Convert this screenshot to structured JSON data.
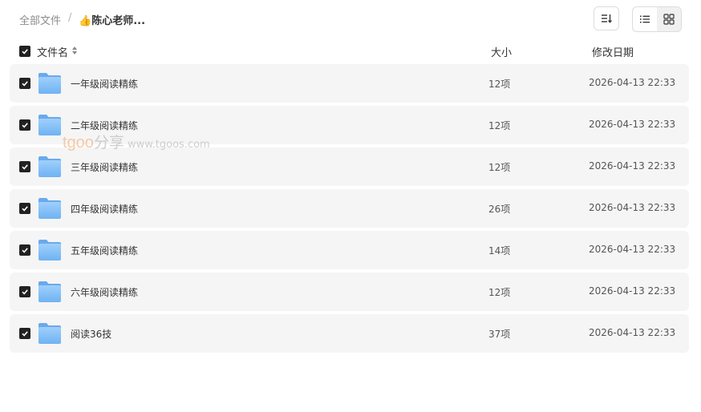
{
  "breadcrumb": {
    "root": "全部文件",
    "separator": "/",
    "current_icon": "👍",
    "current": "陈心老师..."
  },
  "toolbar": {
    "sort_icon": "sort-icon",
    "list_view_icon": "list-view-icon",
    "grid_view_icon": "grid-view-icon"
  },
  "table": {
    "headers": {
      "name": "文件名",
      "size": "大小",
      "date": "修改日期"
    },
    "rows": [
      {
        "name": "一年级阅读精练",
        "size": "12项",
        "date": "2026-04-13 22:33",
        "checked": true
      },
      {
        "name": "二年级阅读精练",
        "size": "12项",
        "date": "2026-04-13 22:33",
        "checked": true
      },
      {
        "name": "三年级阅读精练",
        "size": "12项",
        "date": "2026-04-13 22:33",
        "checked": true
      },
      {
        "name": "四年级阅读精练",
        "size": "26项",
        "date": "2026-04-13 22:33",
        "checked": true
      },
      {
        "name": "五年级阅读精练",
        "size": "14项",
        "date": "2026-04-13 22:33",
        "checked": true
      },
      {
        "name": "六年级阅读精练",
        "size": "12项",
        "date": "2026-04-13 22:33",
        "checked": true
      },
      {
        "name": "阅读36技",
        "size": "37项",
        "date": "2026-04-13 22:33",
        "checked": true
      }
    ]
  },
  "watermark": {
    "logo": "tgoo",
    "cn": "分享",
    "url": "www.tgoos.com"
  },
  "colors": {
    "row_bg": "#f5f5f6",
    "checkbox": "#222222",
    "folder": "#7ab8f5",
    "watermark_logo": "#f0a561"
  }
}
